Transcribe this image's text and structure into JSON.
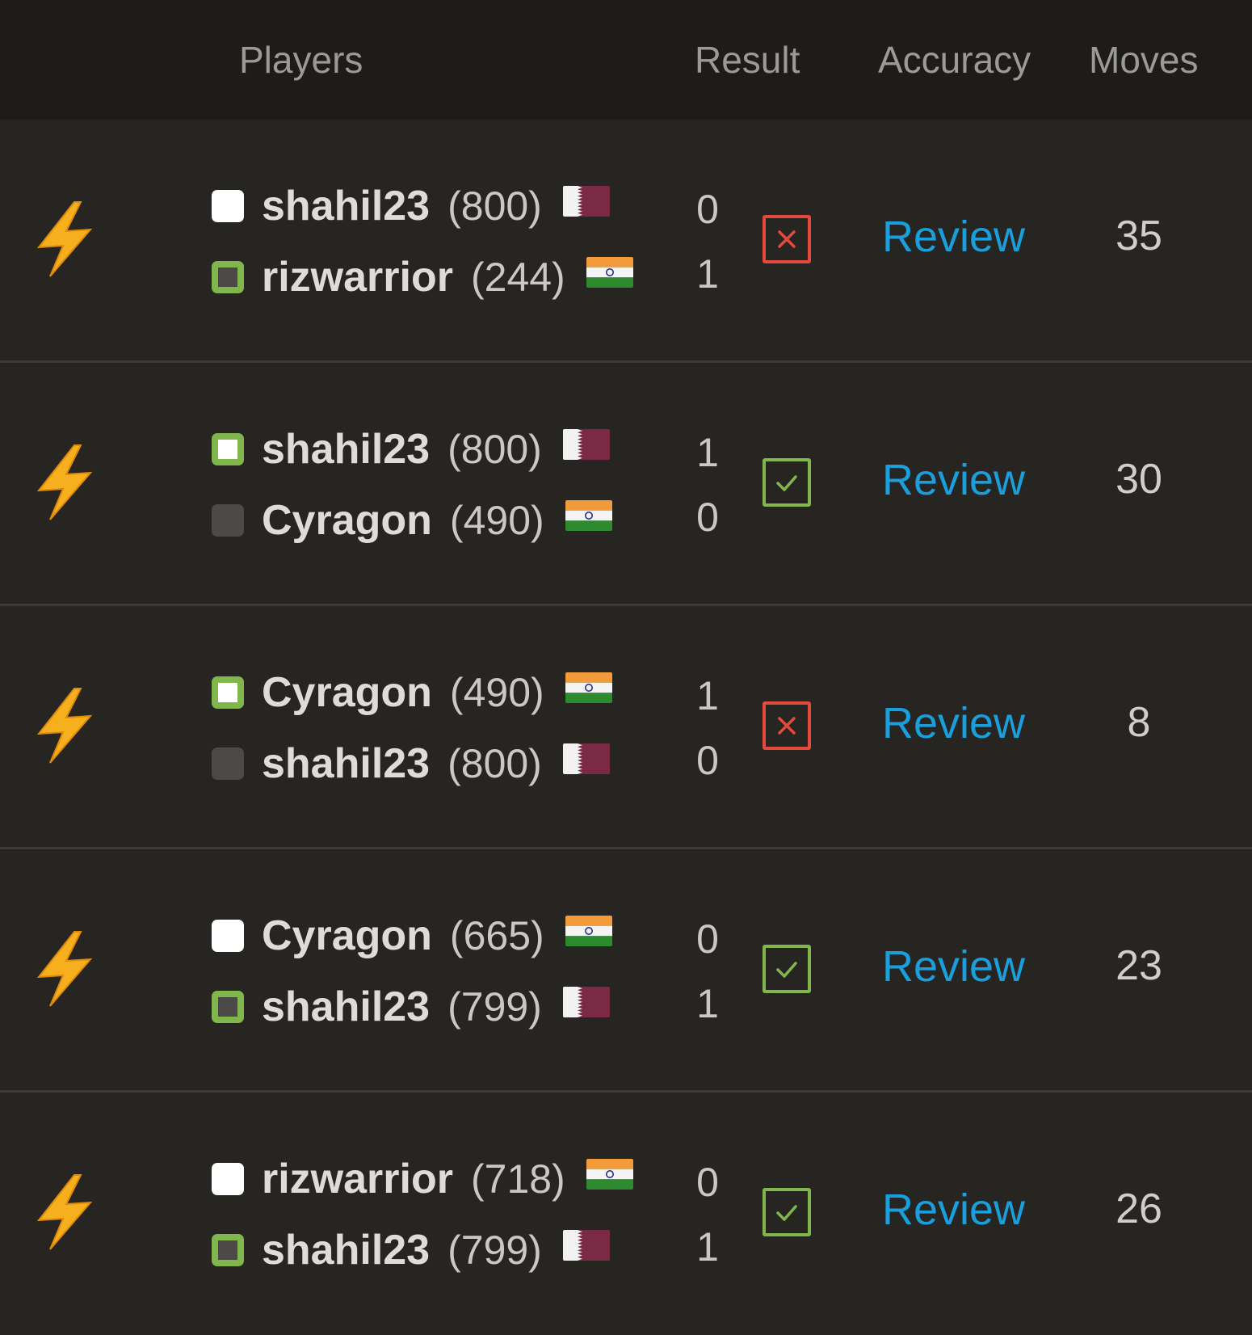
{
  "header": {
    "players": "Players",
    "result": "Result",
    "accuracy": "Accuracy",
    "moves": "Moves"
  },
  "colors": {
    "win": "#81b64c",
    "loss": "#e34a3c",
    "link": "#1a9fdc",
    "bolt": "#f6b01d"
  },
  "games": [
    {
      "time_control_icon": "lightning-bolt-icon",
      "white": {
        "name": "shahil23",
        "rating": "(800)",
        "flag": "qatar-flag-icon",
        "score": "0",
        "won": false
      },
      "black": {
        "name": "rizwarrior",
        "rating": "(244)",
        "flag": "india-flag-icon",
        "score": "1",
        "won": true
      },
      "result": "loss",
      "review_label": "Review",
      "moves": "35"
    },
    {
      "time_control_icon": "lightning-bolt-icon",
      "white": {
        "name": "shahil23",
        "rating": "(800)",
        "flag": "qatar-flag-icon",
        "score": "1",
        "won": true
      },
      "black": {
        "name": "Cyragon",
        "rating": "(490)",
        "flag": "india-flag-icon",
        "score": "0",
        "won": false
      },
      "result": "win",
      "review_label": "Review",
      "moves": "30"
    },
    {
      "time_control_icon": "lightning-bolt-icon",
      "white": {
        "name": "Cyragon",
        "rating": "(490)",
        "flag": "india-flag-icon",
        "score": "1",
        "won": true
      },
      "black": {
        "name": "shahil23",
        "rating": "(800)",
        "flag": "qatar-flag-icon",
        "score": "0",
        "won": false
      },
      "result": "loss",
      "review_label": "Review",
      "moves": "8"
    },
    {
      "time_control_icon": "lightning-bolt-icon",
      "white": {
        "name": "Cyragon",
        "rating": "(665)",
        "flag": "india-flag-icon",
        "score": "0",
        "won": false
      },
      "black": {
        "name": "shahil23",
        "rating": "(799)",
        "flag": "qatar-flag-icon",
        "score": "1",
        "won": true
      },
      "result": "win",
      "review_label": "Review",
      "moves": "23"
    },
    {
      "time_control_icon": "lightning-bolt-icon",
      "white": {
        "name": "rizwarrior",
        "rating": "(718)",
        "flag": "india-flag-icon",
        "score": "0",
        "won": false
      },
      "black": {
        "name": "shahil23",
        "rating": "(799)",
        "flag": "qatar-flag-icon",
        "score": "1",
        "won": true
      },
      "result": "win",
      "review_label": "Review",
      "moves": "26"
    }
  ]
}
